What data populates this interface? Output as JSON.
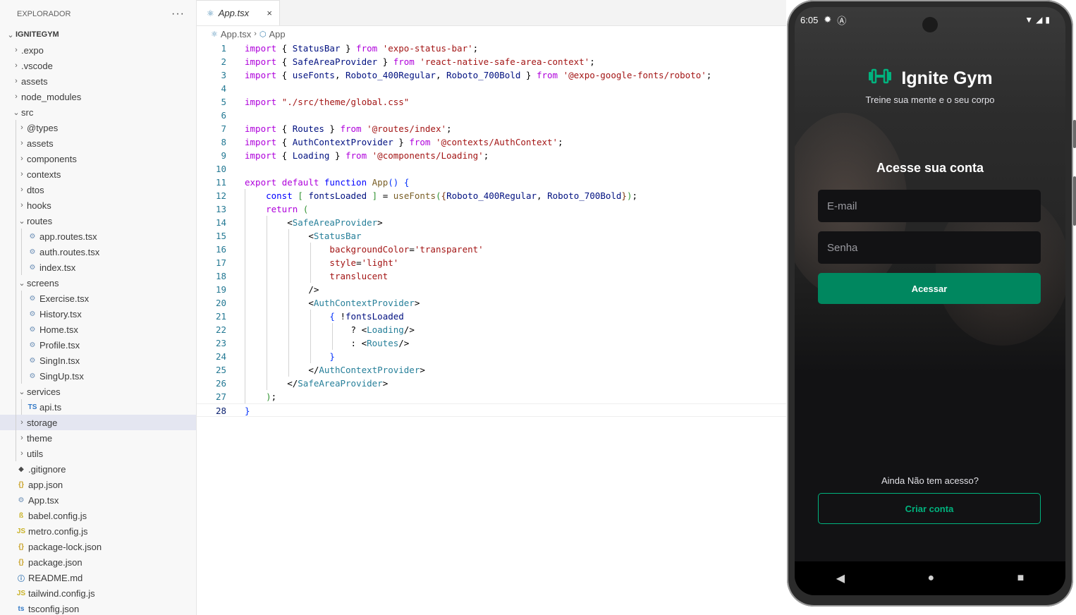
{
  "explorer": {
    "title": "EXPLORADOR",
    "more": "···",
    "root": "IGNITEGYM",
    "items": [
      {
        "label": ".expo",
        "type": "folder",
        "depth": 1
      },
      {
        "label": ".vscode",
        "type": "folder",
        "depth": 1
      },
      {
        "label": "assets",
        "type": "folder",
        "depth": 1
      },
      {
        "label": "node_modules",
        "type": "folder",
        "depth": 1
      },
      {
        "label": "src",
        "type": "folder-open",
        "depth": 1
      },
      {
        "label": "@types",
        "type": "folder",
        "depth": 2
      },
      {
        "label": "assets",
        "type": "folder",
        "depth": 2
      },
      {
        "label": "components",
        "type": "folder",
        "depth": 2
      },
      {
        "label": "contexts",
        "type": "folder",
        "depth": 2
      },
      {
        "label": "dtos",
        "type": "folder",
        "depth": 2
      },
      {
        "label": "hooks",
        "type": "folder",
        "depth": 2
      },
      {
        "label": "routes",
        "type": "folder-open",
        "depth": 2
      },
      {
        "label": "app.routes.tsx",
        "type": "react",
        "depth": 3
      },
      {
        "label": "auth.routes.tsx",
        "type": "react",
        "depth": 3
      },
      {
        "label": "index.tsx",
        "type": "react",
        "depth": 3
      },
      {
        "label": "screens",
        "type": "folder-open",
        "depth": 2
      },
      {
        "label": "Exercise.tsx",
        "type": "react",
        "depth": 3
      },
      {
        "label": "History.tsx",
        "type": "react",
        "depth": 3
      },
      {
        "label": "Home.tsx",
        "type": "react",
        "depth": 3
      },
      {
        "label": "Profile.tsx",
        "type": "react",
        "depth": 3
      },
      {
        "label": "SingIn.tsx",
        "type": "react",
        "depth": 3
      },
      {
        "label": "SingUp.tsx",
        "type": "react",
        "depth": 3
      },
      {
        "label": "services",
        "type": "folder-open",
        "depth": 2
      },
      {
        "label": "api.ts",
        "type": "ts",
        "depth": 3
      },
      {
        "label": "storage",
        "type": "folder",
        "depth": 2,
        "selected": true
      },
      {
        "label": "theme",
        "type": "folder",
        "depth": 2
      },
      {
        "label": "utils",
        "type": "folder",
        "depth": 2
      },
      {
        "label": ".gitignore",
        "type": "git",
        "depth": 1
      },
      {
        "label": "app.json",
        "type": "json",
        "depth": 1
      },
      {
        "label": "App.tsx",
        "type": "react",
        "depth": 1
      },
      {
        "label": "babel.config.js",
        "type": "babel",
        "depth": 1
      },
      {
        "label": "metro.config.js",
        "type": "js",
        "depth": 1
      },
      {
        "label": "package-lock.json",
        "type": "json",
        "depth": 1
      },
      {
        "label": "package.json",
        "type": "json",
        "depth": 1
      },
      {
        "label": "README.md",
        "type": "info",
        "depth": 1
      },
      {
        "label": "tailwind.config.js",
        "type": "js",
        "depth": 1
      },
      {
        "label": "tsconfig.json",
        "type": "tsconfig",
        "depth": 1
      }
    ]
  },
  "editor": {
    "tab_label": "App.tsx",
    "tab_close": "×",
    "breadcrumb": [
      "App.tsx",
      "App"
    ],
    "current_line": 28,
    "lines": [
      [
        [
          "import",
          "kw2"
        ],
        [
          " { ",
          "punc"
        ],
        [
          "StatusBar",
          "id"
        ],
        [
          " } ",
          "punc"
        ],
        [
          "from",
          "kw2"
        ],
        [
          " ",
          "punc"
        ],
        [
          "'expo-status-bar'",
          "str"
        ],
        [
          ";",
          "punc"
        ]
      ],
      [
        [
          "import",
          "kw2"
        ],
        [
          " { ",
          "punc"
        ],
        [
          "SafeAreaProvider",
          "id"
        ],
        [
          " } ",
          "punc"
        ],
        [
          "from",
          "kw2"
        ],
        [
          " ",
          "punc"
        ],
        [
          "'react-native-safe-area-context'",
          "str"
        ],
        [
          ";",
          "punc"
        ]
      ],
      [
        [
          "import",
          "kw2"
        ],
        [
          " { ",
          "punc"
        ],
        [
          "useFonts",
          "id"
        ],
        [
          ", ",
          "punc"
        ],
        [
          "Roboto_400Regular",
          "id"
        ],
        [
          ", ",
          "punc"
        ],
        [
          "Roboto_700Bold",
          "id"
        ],
        [
          " } ",
          "punc"
        ],
        [
          "from",
          "kw2"
        ],
        [
          " ",
          "punc"
        ],
        [
          "'@expo-google-fonts/roboto'",
          "str"
        ],
        [
          ";",
          "punc"
        ]
      ],
      [],
      [
        [
          "import",
          "kw2"
        ],
        [
          " ",
          "punc"
        ],
        [
          "\"./src/theme/global.css\"",
          "str"
        ]
      ],
      [],
      [
        [
          "import",
          "kw2"
        ],
        [
          " { ",
          "punc"
        ],
        [
          "Routes",
          "id"
        ],
        [
          " } ",
          "punc"
        ],
        [
          "from",
          "kw2"
        ],
        [
          " ",
          "punc"
        ],
        [
          "'@routes/index'",
          "str"
        ],
        [
          ";",
          "punc"
        ]
      ],
      [
        [
          "import",
          "kw2"
        ],
        [
          " { ",
          "punc"
        ],
        [
          "AuthContextProvider",
          "id"
        ],
        [
          " } ",
          "punc"
        ],
        [
          "from",
          "kw2"
        ],
        [
          " ",
          "punc"
        ],
        [
          "'@contexts/AuthContext'",
          "str"
        ],
        [
          ";",
          "punc"
        ]
      ],
      [
        [
          "import",
          "kw2"
        ],
        [
          " { ",
          "punc"
        ],
        [
          "Loading",
          "id"
        ],
        [
          " } ",
          "punc"
        ],
        [
          "from",
          "kw2"
        ],
        [
          " ",
          "punc"
        ],
        [
          "'@components/Loading'",
          "str"
        ],
        [
          ";",
          "punc"
        ]
      ],
      [],
      [
        [
          "export",
          "kw2"
        ],
        [
          " ",
          "punc"
        ],
        [
          "default",
          "kw2"
        ],
        [
          " ",
          "punc"
        ],
        [
          "function",
          "kw"
        ],
        [
          " ",
          "punc"
        ],
        [
          "App",
          "fn"
        ],
        [
          "()",
          "br1"
        ],
        [
          " ",
          "punc"
        ],
        [
          "{",
          "br1"
        ]
      ],
      [
        [
          "    ",
          "punc"
        ],
        [
          "const",
          "kw"
        ],
        [
          " ",
          "punc"
        ],
        [
          "[",
          "br2"
        ],
        [
          " ",
          "punc"
        ],
        [
          "fontsLoaded",
          "id"
        ],
        [
          " ",
          "punc"
        ],
        [
          "]",
          "br2"
        ],
        [
          " = ",
          "punc"
        ],
        [
          "useFonts",
          "fn"
        ],
        [
          "(",
          "br2"
        ],
        [
          "{",
          "br3"
        ],
        [
          "Roboto_400Regular",
          "id"
        ],
        [
          ", ",
          "punc"
        ],
        [
          "Roboto_700Bold",
          "id"
        ],
        [
          "}",
          "br3"
        ],
        [
          ")",
          "br2"
        ],
        [
          ";",
          "punc"
        ]
      ],
      [
        [
          "    ",
          "punc"
        ],
        [
          "return",
          "kw2"
        ],
        [
          " ",
          "punc"
        ],
        [
          "(",
          "br2"
        ]
      ],
      [
        [
          "        ",
          "punc"
        ],
        [
          "<",
          "punc"
        ],
        [
          "SafeAreaProvider",
          "tag"
        ],
        [
          ">",
          "punc"
        ]
      ],
      [
        [
          "            ",
          "punc"
        ],
        [
          "<",
          "punc"
        ],
        [
          "StatusBar",
          "tag"
        ]
      ],
      [
        [
          "                ",
          "punc"
        ],
        [
          "backgroundColor",
          "str"
        ],
        [
          "=",
          "punc"
        ],
        [
          "'transparent'",
          "str"
        ]
      ],
      [
        [
          "                ",
          "punc"
        ],
        [
          "style",
          "str"
        ],
        [
          "=",
          "punc"
        ],
        [
          "'light'",
          "str"
        ]
      ],
      [
        [
          "                ",
          "punc"
        ],
        [
          "translucent",
          "str"
        ]
      ],
      [
        [
          "            ",
          "punc"
        ],
        [
          "/>",
          "punc"
        ]
      ],
      [
        [
          "            ",
          "punc"
        ],
        [
          "<",
          "punc"
        ],
        [
          "AuthContextProvider",
          "tag"
        ],
        [
          ">",
          "punc"
        ]
      ],
      [
        [
          "                ",
          "punc"
        ],
        [
          "{",
          "br1"
        ],
        [
          " !",
          "punc"
        ],
        [
          "fontsLoaded",
          "id"
        ]
      ],
      [
        [
          "                    ",
          "punc"
        ],
        [
          "? ",
          "punc"
        ],
        [
          "<",
          "punc"
        ],
        [
          "Loading",
          "tag"
        ],
        [
          "/>",
          "punc"
        ]
      ],
      [
        [
          "                    ",
          "punc"
        ],
        [
          ": ",
          "punc"
        ],
        [
          "<",
          "punc"
        ],
        [
          "Routes",
          "tag"
        ],
        [
          "/>",
          "punc"
        ]
      ],
      [
        [
          "                ",
          "punc"
        ],
        [
          "}",
          "br1"
        ]
      ],
      [
        [
          "            ",
          "punc"
        ],
        [
          "</",
          "punc"
        ],
        [
          "AuthContextProvider",
          "tag"
        ],
        [
          ">",
          "punc"
        ]
      ],
      [
        [
          "        ",
          "punc"
        ],
        [
          "</",
          "punc"
        ],
        [
          "SafeAreaProvider",
          "tag"
        ],
        [
          ">",
          "punc"
        ]
      ],
      [
        [
          "    ",
          "punc"
        ],
        [
          ")",
          "br2"
        ],
        [
          ";",
          "punc"
        ]
      ],
      [
        [
          "}",
          "br1"
        ]
      ]
    ]
  },
  "phone": {
    "time": "6:05",
    "brand_name": "Ignite Gym",
    "tagline": "Treine sua mente e o seu corpo",
    "login_title": "Acesse sua conta",
    "email_placeholder": "E-mail",
    "password_placeholder": "Senha",
    "login_button": "Acessar",
    "no_account_text": "Ainda Não tem acesso?",
    "signup_button": "Criar conta",
    "accent_color": "#00875f"
  }
}
